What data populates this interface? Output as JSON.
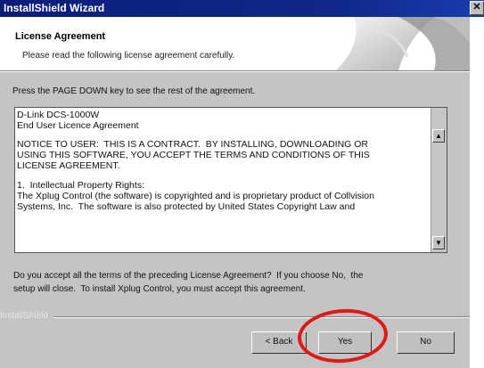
{
  "window": {
    "title": "InstallShield Wizard",
    "close_label": "✕"
  },
  "header": {
    "title": "License Agreement",
    "subtitle": "Please read the following license agreement carefully."
  },
  "instruction": "Press the PAGE DOWN key to see the rest of the agreement.",
  "license": {
    "lines": [
      "D-Link DCS-1000W",
      "End User Licence Agreement",
      "NOTICE TO USER:  THIS IS A CONTRACT.  BY INSTALLING, DOWNLOADING OR",
      "USING THIS SOFTWARE, YOU ACCEPT THE TERMS AND CONDITIONS OF THIS",
      "LICENSE AGREEMENT.",
      "1.  Intellectual Property Rights:",
      "The Xplug Control (the software) is copyrighted and is proprietary product of Collvision",
      "Systems, Inc.  The software is also protected by United States Copyright Law and"
    ]
  },
  "question": {
    "line1": "Do you accept all the terms of the preceding License Agreement?  If you choose No,  the",
    "line2": "setup will close.  To install Xplug Control, you must accept this agreement."
  },
  "footer": {
    "brand": "InstallShield",
    "back_label": "< Back",
    "yes_label": "Yes",
    "no_label": "No"
  },
  "colors": {
    "title_bar": "#0a1e78",
    "dialog_bg": "#c4c4c4",
    "annotation_circle": "#e01818"
  }
}
